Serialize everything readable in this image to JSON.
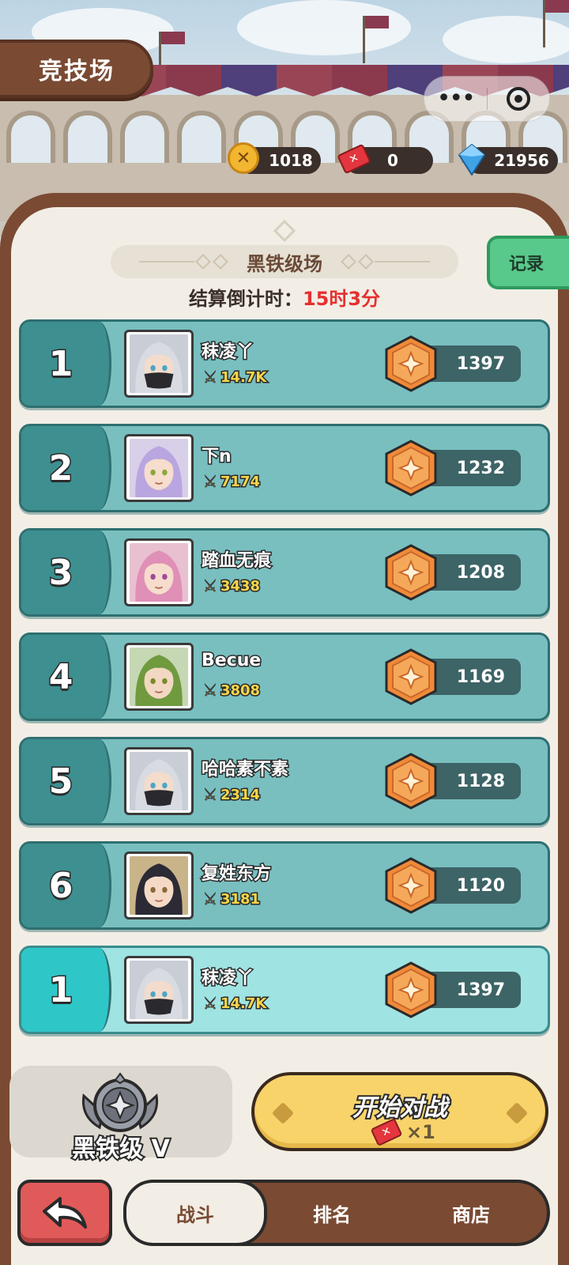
{
  "header": {
    "title": "竞技场"
  },
  "capsule": {
    "more_icon": "more-dots-icon",
    "close_icon": "target-circle-icon"
  },
  "currencies": [
    {
      "icon": "coin-icon",
      "value": "1018"
    },
    {
      "icon": "ticket-icon",
      "value": "0"
    },
    {
      "icon": "gem-icon",
      "value": "21956"
    }
  ],
  "league": {
    "name": "黑铁级场",
    "countdown_label": "结算倒计时：",
    "countdown_value": "15时3分"
  },
  "record_button": "记录",
  "rankings": [
    {
      "rank": "1",
      "name": "秣凌丫",
      "power": "14.7K",
      "score": "1397",
      "avatar": "silver-hair-masked"
    },
    {
      "rank": "2",
      "name": "下n",
      "power": "7174",
      "score": "1232",
      "avatar": "lavender-hair"
    },
    {
      "rank": "3",
      "name": "踏血无痕",
      "power": "3438",
      "score": "1208",
      "avatar": "pink-hair"
    },
    {
      "rank": "4",
      "name": "Becue",
      "power": "3808",
      "score": "1169",
      "avatar": "green-hair"
    },
    {
      "rank": "5",
      "name": "哈哈素不素",
      "power": "2314",
      "score": "1128",
      "avatar": "silver-hair-masked"
    },
    {
      "rank": "6",
      "name": "复姓东方",
      "power": "3181",
      "score": "1120",
      "avatar": "dark-hair"
    }
  ],
  "my_rank": {
    "rank": "1",
    "name": "秣凌丫",
    "power": "14.7K",
    "score": "1397",
    "avatar": "silver-hair-masked"
  },
  "tier": {
    "label": "黑铁级 V",
    "icon": "iron-rank-emblem-icon"
  },
  "start_battle": {
    "label": "开始对战",
    "cost": "×1"
  },
  "nav": {
    "back_icon": "back-arrow-icon",
    "tabs": [
      "战斗",
      "排名",
      "商店"
    ],
    "active": "战斗"
  },
  "colors": {
    "accent_brown": "#7a4a33",
    "row_teal": "#79bfc0",
    "highlight_row": "#9fe3e2",
    "countdown_red": "#e63030",
    "start_yellow": "#f8d36a"
  }
}
